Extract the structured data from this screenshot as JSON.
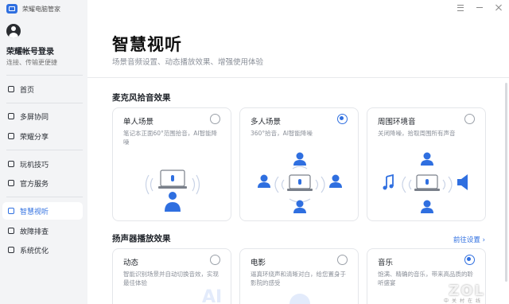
{
  "app": {
    "title": "荣耀电脑管家"
  },
  "account": {
    "title": "荣耀帐号登录",
    "subtitle": "连接、传输更便捷"
  },
  "sidebar": {
    "items": [
      {
        "label": "首页",
        "icon": "home-icon"
      },
      {
        "label": "多屏协同",
        "icon": "multi-screen-icon"
      },
      {
        "label": "荣耀分享",
        "icon": "share-icon"
      },
      {
        "label": "玩机技巧",
        "icon": "tips-icon"
      },
      {
        "label": "官方服务",
        "icon": "service-icon"
      },
      {
        "label": "智慧视听",
        "icon": "headphone-icon",
        "active": true
      },
      {
        "label": "故障排查",
        "icon": "troubleshoot-icon"
      },
      {
        "label": "系统优化",
        "icon": "optimize-icon"
      }
    ]
  },
  "page": {
    "title": "智慧视听",
    "subtitle": "场景音频设置、动态播放效果、增强使用体验"
  },
  "mic_section": {
    "title": "麦克风拾音效果",
    "cards": [
      {
        "title": "单人场景",
        "desc": "笔记本正面60°范围拾音，AI智能降噪",
        "checked": false
      },
      {
        "title": "多人场景",
        "desc": "360°拾音，AI智能降噪",
        "checked": true
      },
      {
        "title": "周围环境音",
        "desc": "关闭降噪，拾取周围所有声音",
        "checked": false
      }
    ]
  },
  "speaker_section": {
    "title": "扬声器播放效果",
    "link": "前往设置 ›",
    "cards": [
      {
        "title": "动态",
        "desc": "智能识别场景并自动切换音效，实现最佳体验",
        "checked": false,
        "deco": "AI"
      },
      {
        "title": "电影",
        "desc": "逼真环绕声和清晰对白，给您置身于影院的感受",
        "checked": false
      },
      {
        "title": "音乐",
        "desc": "饱满、精确的音乐，带来高品质的聆听盛宴",
        "checked": true
      }
    ]
  },
  "watermark": {
    "text": "ZOL",
    "sub": "中关村在线"
  },
  "colors": {
    "accent": "#2f6fe0",
    "sidebar_bg": "#f3f4f6",
    "active_bg": "#ffffff"
  }
}
